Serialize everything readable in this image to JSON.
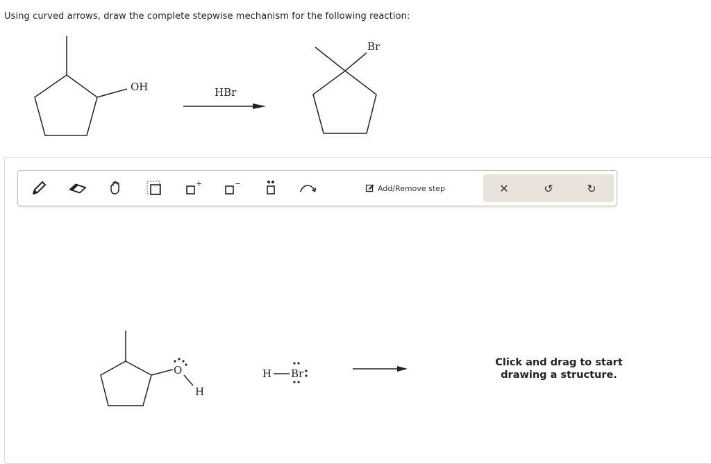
{
  "question": "Using curved arrows, draw the complete stepwise mechanism for the following reaction:",
  "reaction": {
    "reactant_group": "OH",
    "reagent": "HBr",
    "product_group": "Br"
  },
  "toolbar": {
    "tools": [
      {
        "name": "pencil-tool-icon"
      },
      {
        "name": "eraser-tool-icon"
      },
      {
        "name": "hand-tool-icon"
      },
      {
        "name": "select-tool-icon"
      },
      {
        "name": "positive-charge-tool-icon",
        "symbol": "+"
      },
      {
        "name": "negative-charge-tool-icon",
        "symbol": "−"
      },
      {
        "name": "lone-pair-tool-icon"
      },
      {
        "name": "curved-arrow-tool-icon"
      }
    ],
    "add_remove_label": "Add/Remove step",
    "actions": [
      {
        "name": "clear-button",
        "symbol": "✕"
      },
      {
        "name": "undo-button",
        "symbol": "↺"
      },
      {
        "name": "redo-button",
        "symbol": "↻"
      }
    ]
  },
  "canvas": {
    "oxygen": "O",
    "hydrogen": "H",
    "hbr_h": "H",
    "hbr_br": "Br",
    "hint": "Click and drag to start drawing a structure."
  }
}
